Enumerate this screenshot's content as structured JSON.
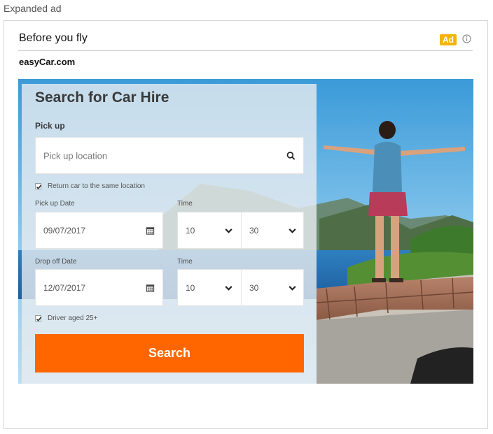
{
  "page": {
    "label": "Expanded ad"
  },
  "ad": {
    "headline": "Before you fly",
    "badge": "Ad",
    "advertiser": "easyCar.com"
  },
  "form": {
    "title": "Search for Car Hire",
    "pickup_heading": "Pick up",
    "pickup_location_placeholder": "Pick up location",
    "return_same_location_label": "Return car to the same location",
    "return_same_location_checked": true,
    "pickup_date_label": "Pick up Date",
    "pickup_date": "09/07/2017",
    "pickup_time_label": "Time",
    "pickup_hour": "10",
    "pickup_minute": "30",
    "dropoff_date_label": "Drop off Date",
    "dropoff_date": "12/07/2017",
    "dropoff_time_label": "Time",
    "dropoff_hour": "10",
    "dropoff_minute": "30",
    "driver_age_label": "Driver aged 25+",
    "driver_age_checked": true,
    "search_button": "Search"
  },
  "colors": {
    "accent": "#ff6600",
    "ad_badge": "#f4b400"
  },
  "icons": [
    "info-icon",
    "search-icon",
    "calendar-icon",
    "chevron-down-icon",
    "check-icon"
  ]
}
